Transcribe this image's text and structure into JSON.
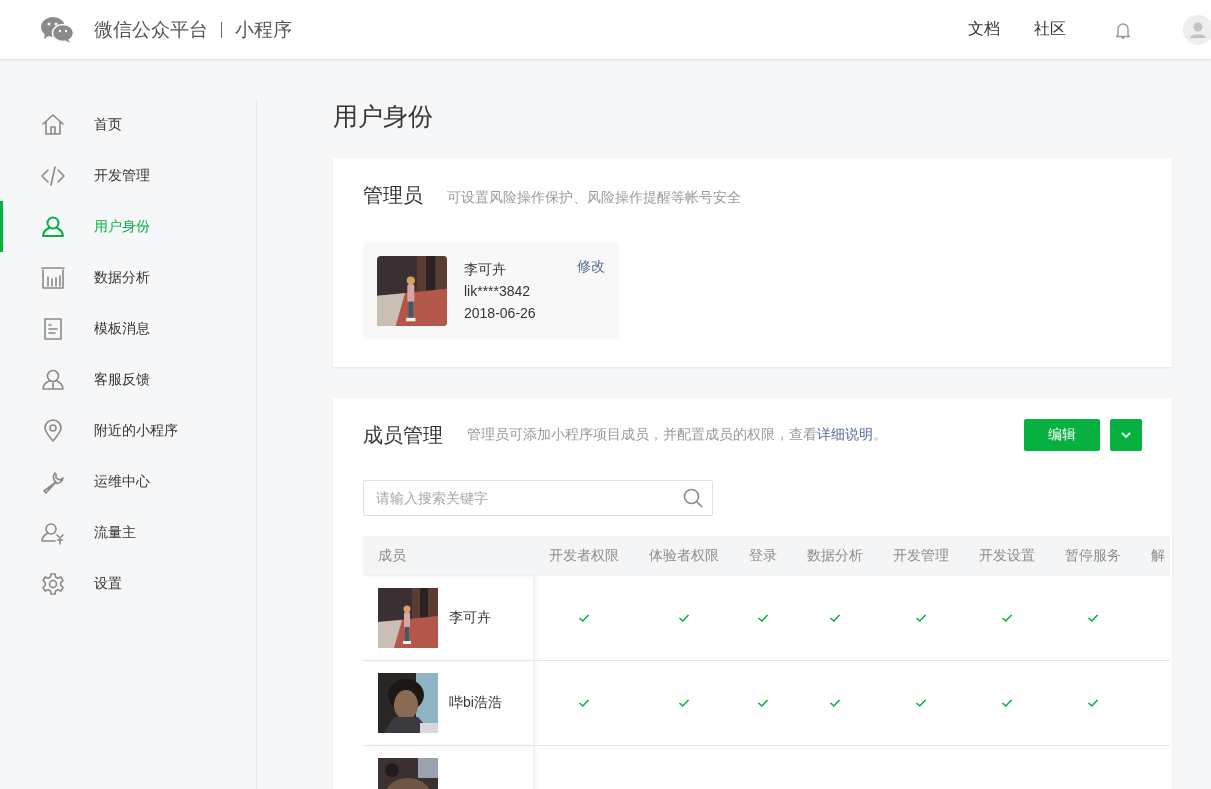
{
  "header": {
    "brand": "微信公众平台",
    "product": "小程序",
    "links": [
      "文档",
      "社区"
    ]
  },
  "sidebar": {
    "items": [
      {
        "label": "首页",
        "selected": false
      },
      {
        "label": "开发管理",
        "selected": false
      },
      {
        "label": "用户身份",
        "selected": true
      },
      {
        "label": "数据分析",
        "selected": false
      },
      {
        "label": "模板消息",
        "selected": false
      },
      {
        "label": "客服反馈",
        "selected": false
      },
      {
        "label": "附近的小程序",
        "selected": false
      },
      {
        "label": "运维中心",
        "selected": false
      },
      {
        "label": "流量主",
        "selected": false
      },
      {
        "label": "设置",
        "selected": false
      }
    ]
  },
  "page_title": "用户身份",
  "admin": {
    "title": "管理员",
    "description": "可设置风险操作保护、风险操作提醒等帐号安全",
    "name": "李可卉",
    "account": "lik****3842",
    "date": "2018-06-26",
    "edit_link": "修改"
  },
  "members": {
    "title": "成员管理",
    "description": "管理员可添加小程序项目成员，并配置成员的权限，查看",
    "description_link": "详细说明",
    "description_end": "。",
    "edit_button": "编辑",
    "search": {
      "placeholder": "请输入搜索关键字"
    },
    "table": {
      "columns": [
        "成员",
        "开发者权限",
        "体验者权限",
        "登录",
        "数据分析",
        "开发管理",
        "开发设置",
        "暂停服务",
        "解"
      ],
      "rows": [
        {
          "name": "李可卉",
          "avatar": {
            "kind": "picture"
          },
          "permissions": [
            true,
            true,
            true,
            true,
            true,
            true,
            true,
            false
          ]
        },
        {
          "name": "哔bi浩浩",
          "avatar": {
            "kind": "picture"
          },
          "permissions": [
            true,
            true,
            true,
            true,
            true,
            true,
            true,
            false
          ]
        },
        {
          "avatar": {
            "kind": "picture"
          }
        }
      ]
    }
  }
}
